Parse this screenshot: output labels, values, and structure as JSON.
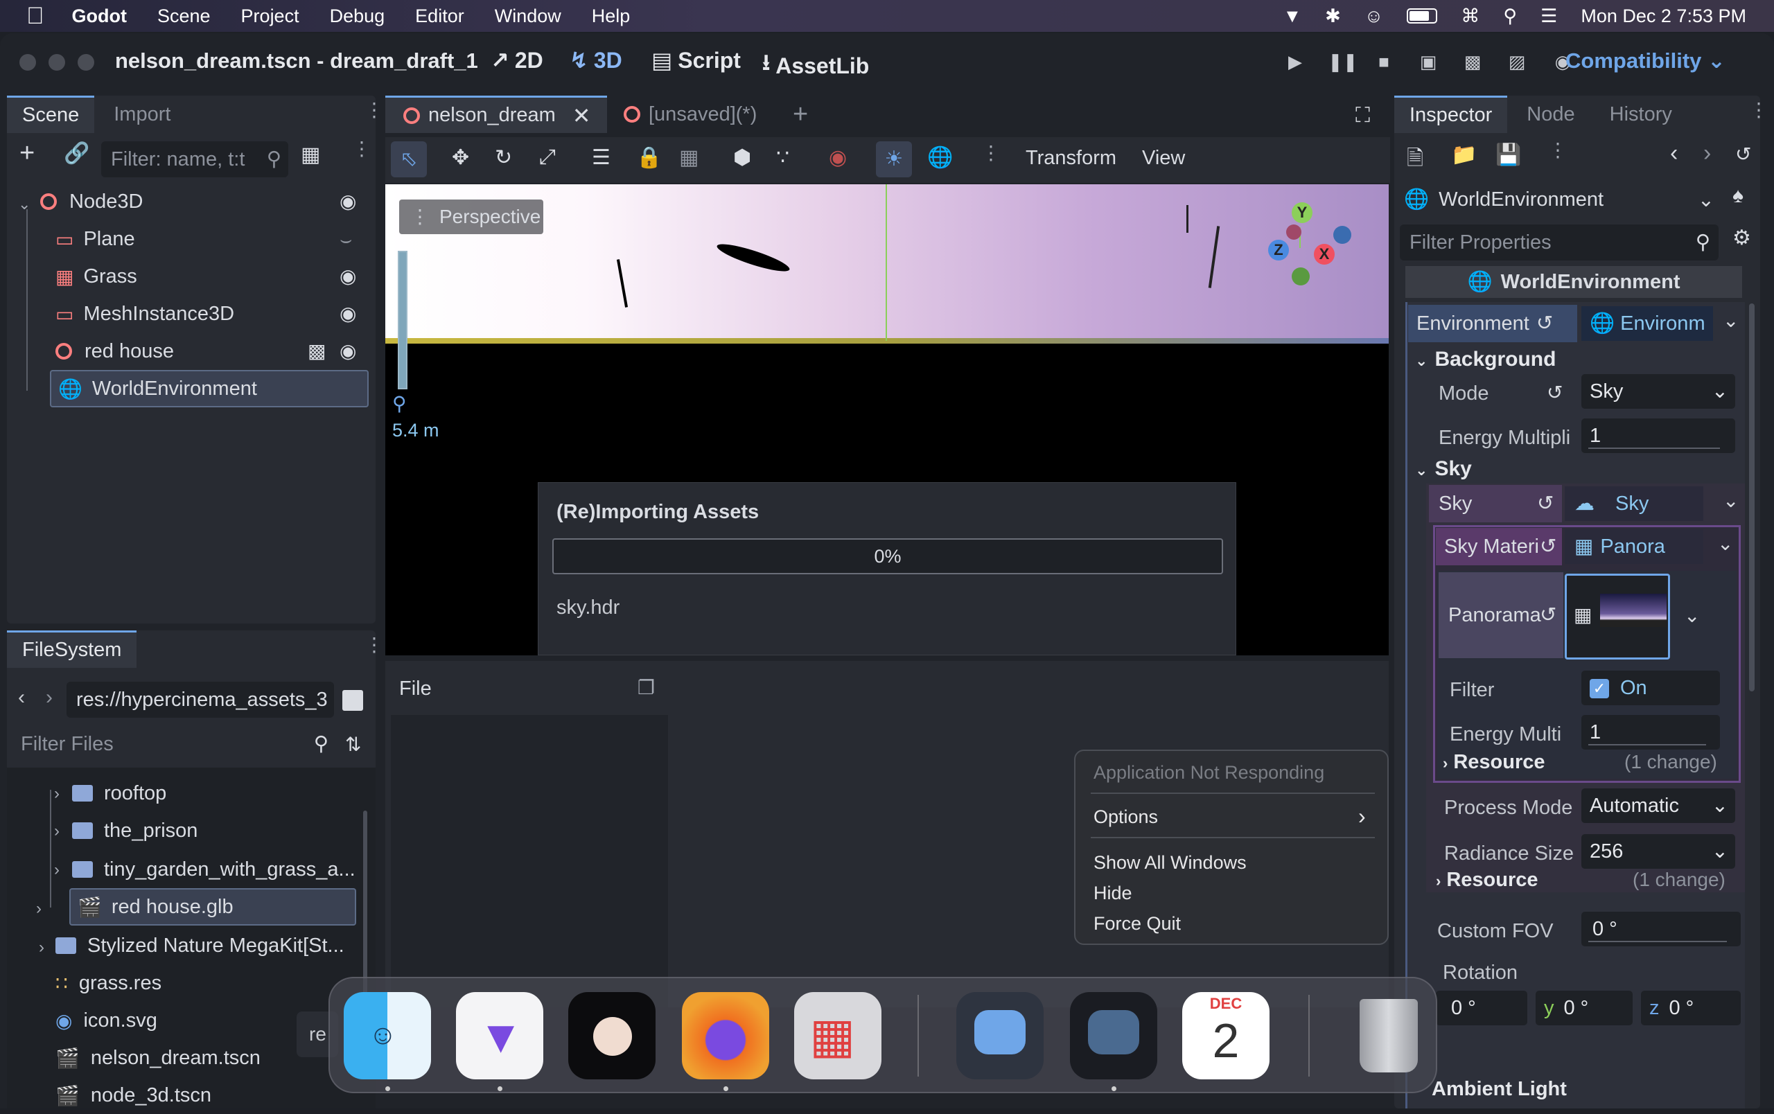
{
  "menubar": {
    "app": "Godot",
    "items": [
      "Scene",
      "Project",
      "Debug",
      "Editor",
      "Window",
      "Help"
    ],
    "datetime": "Mon Dec 2  7:53 PM"
  },
  "titlebar": {
    "title": "nelson_dream.tscn - dream_draft_1",
    "btn_2d": "2D",
    "btn_3d": "3D",
    "btn_script": "Script",
    "btn_assetlib": "AssetLib",
    "renderer": "Compatibility"
  },
  "scene_dock": {
    "tab_scene": "Scene",
    "tab_import": "Import",
    "filter_placeholder": "Filter: name, t:t",
    "nodes": [
      {
        "label": "Node3D"
      },
      {
        "label": "Plane"
      },
      {
        "label": "Grass"
      },
      {
        "label": "MeshInstance3D"
      },
      {
        "label": "red house"
      },
      {
        "label": "WorldEnvironment"
      }
    ]
  },
  "filesystem": {
    "tab": "FileSystem",
    "path": "res://hypercinema_assets_3",
    "filter_placeholder": "Filter Files",
    "items": [
      {
        "label": "rooftop"
      },
      {
        "label": "the_prison"
      },
      {
        "label": "tiny_garden_with_grass_a..."
      },
      {
        "label": "red house.glb"
      },
      {
        "label": "Stylized Nature MegaKit[St..."
      },
      {
        "label": "grass.res"
      },
      {
        "label": "icon.svg"
      },
      {
        "label": "nelson_dream.tscn"
      },
      {
        "label": "node_3d.tscn"
      }
    ],
    "truncated_label": "re"
  },
  "editor_tabs": {
    "tab1": "nelson_dream",
    "tab2": "[unsaved](*)"
  },
  "viewport_toolbar": {
    "transform": "Transform",
    "view": "View"
  },
  "viewport": {
    "perspective": "Perspective",
    "zoom": "5.4 m",
    "gizmo": {
      "y": "Y",
      "x": "X",
      "z": "Z"
    }
  },
  "import_dialog": {
    "title": "(Re)Importing Assets",
    "progress_text": "0%",
    "progress": 0,
    "file": "sky.hdr"
  },
  "bottom_panel": {
    "file_label": "File"
  },
  "inspector": {
    "tab_inspector": "Inspector",
    "tab_node": "Node",
    "tab_history": "History",
    "object": "WorldEnvironment",
    "filter_placeholder": "Filter Properties",
    "header": "WorldEnvironment",
    "environment_label": "Environment",
    "environment_value": "Environm",
    "background_section": "Background",
    "mode_label": "Mode",
    "mode_value": "Sky",
    "energy_label": "Energy Multipli",
    "energy_value": "1",
    "sky_section": "Sky",
    "sky_label": "Sky",
    "sky_value": "Sky",
    "sky_material_label": "Sky Materi",
    "sky_material_value": "Panora",
    "panorama_label": "Panorama",
    "filter_label": "Filter",
    "filter_value": "On",
    "energy_multi_label": "Energy Multi",
    "energy_multi_value": "1",
    "resource_label": "Resource",
    "resource_change": "(1 change)",
    "process_mode_label": "Process Mode",
    "process_mode_value": "Automatic",
    "radiance_label": "Radiance Size",
    "radiance_value": "256",
    "resource2_label": "Resource",
    "resource2_change": "(1 change)",
    "custom_fov_label": "Custom FOV",
    "custom_fov_value": "0 °",
    "rotation_label": "Rotation",
    "rot_x": "0 °",
    "rot_y_axis": "y",
    "rot_y": "0 °",
    "rot_z_axis": "z",
    "rot_z": "0 °",
    "ambient_label": "Ambient Light"
  },
  "context_menu": {
    "header": "Application Not Responding",
    "options": "Options",
    "show_all": "Show All Windows",
    "hide": "Hide",
    "force_quit": "Force Quit"
  },
  "dock": {
    "calendar_month": "DEC",
    "calendar_day": "2"
  },
  "colors": {
    "accent": "#6fa6e8",
    "node_red": "#fc7f7f",
    "folder": "#8fa8d8",
    "sky_resource_bg": "#4a3b5a"
  }
}
